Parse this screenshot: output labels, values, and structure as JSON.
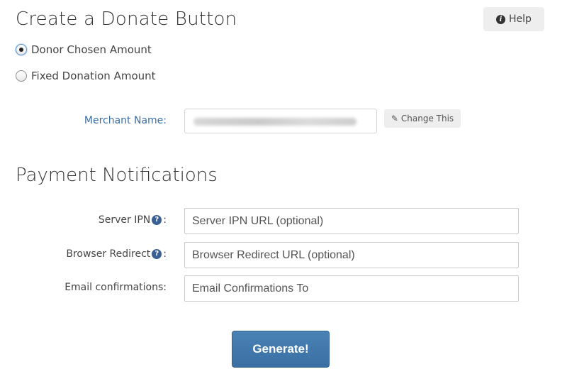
{
  "header": {
    "title": "Create a Donate Button",
    "help_label": "Help"
  },
  "amount_options": [
    {
      "label": "Donor Chosen Amount",
      "selected": true
    },
    {
      "label": "Fixed Donation Amount",
      "selected": false
    }
  ],
  "merchant": {
    "label": "Merchant Name:",
    "change_label": "Change This"
  },
  "notifications": {
    "title": "Payment Notifications",
    "server_ipn": {
      "label": "Server IPN",
      "suffix": ":",
      "placeholder": "Server IPN URL (optional)",
      "value": ""
    },
    "browser_redirect": {
      "label": "Browser Redirect",
      "suffix": ":",
      "placeholder": "Browser Redirect URL (optional)",
      "value": ""
    },
    "email": {
      "label": "Email confirmations:",
      "placeholder": "Email Confirmations To",
      "value": ""
    }
  },
  "generate_label": "Generate!",
  "colors": {
    "primary_button": "#3f76ab",
    "label_link": "#3a6ea5",
    "help_icon": "#3a5f94"
  }
}
